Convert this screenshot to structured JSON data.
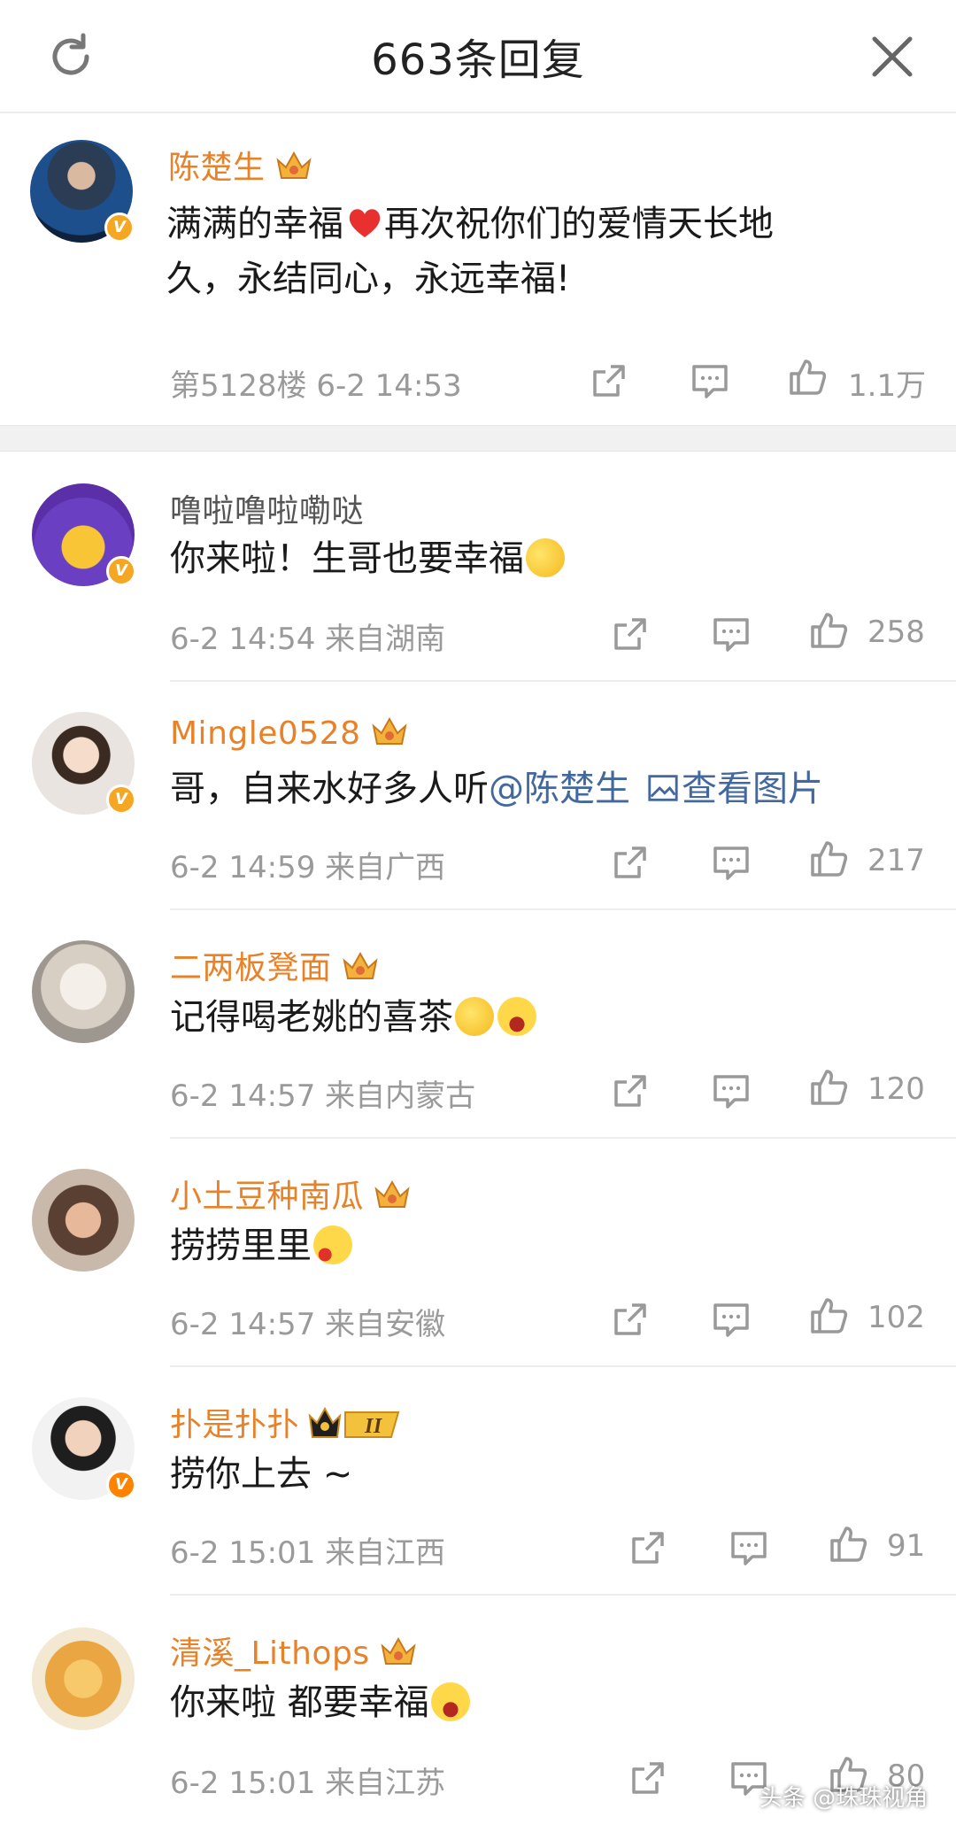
{
  "header": {
    "title": "663条回复",
    "refresh_icon": "refresh-icon",
    "close_icon": "close-icon"
  },
  "main_comment": {
    "user": "陈楚生",
    "line1": "满满的幸福",
    "line1b": "再次祝你们的爱情天长地",
    "line2": "久，永结同心，永远幸福!",
    "floor_time": "第5128楼 6-2 14:53",
    "likes": "1.1万"
  },
  "replies": [
    {
      "user": "噜啦噜啦嘞哒",
      "text": "你来啦！生哥也要幸福",
      "meta": "6-2 14:54  来自湖南",
      "likes": "258"
    },
    {
      "user": "Mingle0528",
      "text": "哥，自来水好多人听",
      "mention": "@陈楚生",
      "image_link": "查看图片",
      "meta": "6-2 14:59  来自广西",
      "likes": "217"
    },
    {
      "user": "二两板凳面",
      "text": "记得喝老姚的喜茶",
      "meta": "6-2 14:57  来自内蒙古",
      "likes": "120"
    },
    {
      "user": "小土豆种南瓜",
      "text": "捞捞里里",
      "meta": "6-2 14:57  来自安徽",
      "likes": "102"
    },
    {
      "user": "扑是扑扑",
      "text": "捞你上去 ~",
      "meta": "6-2 15:01  来自江西",
      "likes": "91"
    },
    {
      "user": "清溪_Lithops",
      "text": "你来啦 都要幸福",
      "meta": "6-2 15:01  来自江苏",
      "likes": "80"
    }
  ],
  "watermark": "头条 @珠珠视角",
  "colors": {
    "gold_name": "#e8822a",
    "link": "#43689e",
    "meta": "#9a9a9a"
  }
}
